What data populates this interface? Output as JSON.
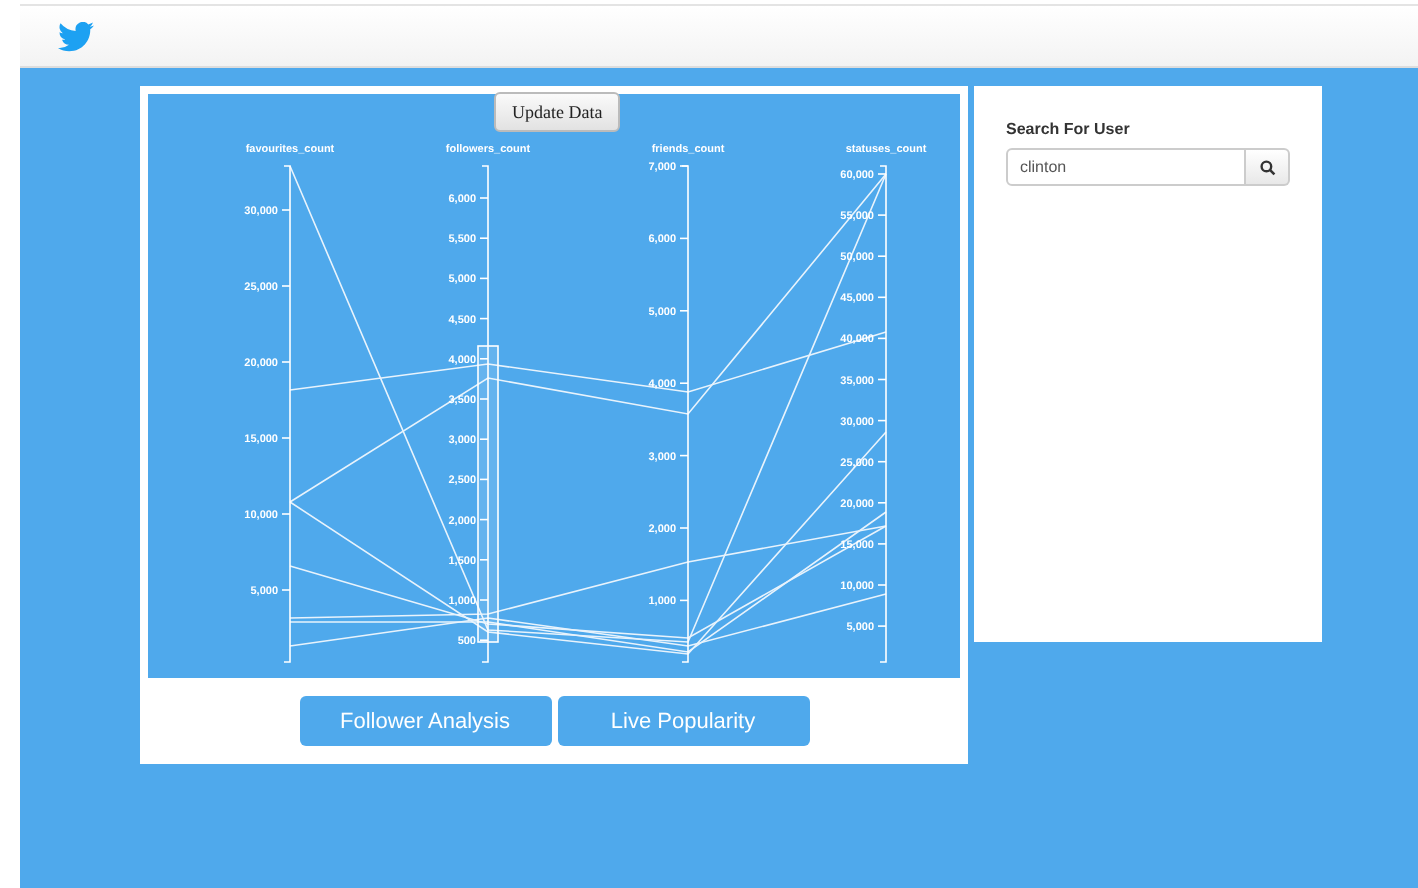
{
  "chart": {
    "update_button": "Update Data",
    "axes": [
      {
        "title": "favourites_count",
        "ticks": [
          "30,000",
          "25,000",
          "20,000",
          "15,000",
          "10,000",
          "5,000"
        ]
      },
      {
        "title": "followers_count",
        "ticks": [
          "6,000",
          "5,500",
          "5,000",
          "4,500",
          "4,000",
          "3,500",
          "3,000",
          "2,500",
          "2,000",
          "1,500",
          "1,000",
          "500"
        ]
      },
      {
        "title": "friends_count",
        "ticks": [
          "7,000",
          "6,000",
          "5,000",
          "4,000",
          "3,000",
          "2,000",
          "1,000"
        ]
      },
      {
        "title": "statuses_count",
        "ticks": [
          "60,000",
          "55,000",
          "50,000",
          "45,000",
          "40,000",
          "35,000",
          "30,000",
          "25,000",
          "20,000",
          "15,000",
          "10,000",
          "5,000"
        ]
      }
    ]
  },
  "buttons": [
    "Follower Analysis",
    "Live Popularity"
  ],
  "search": {
    "label": "Search For User",
    "value": "clinton"
  }
}
